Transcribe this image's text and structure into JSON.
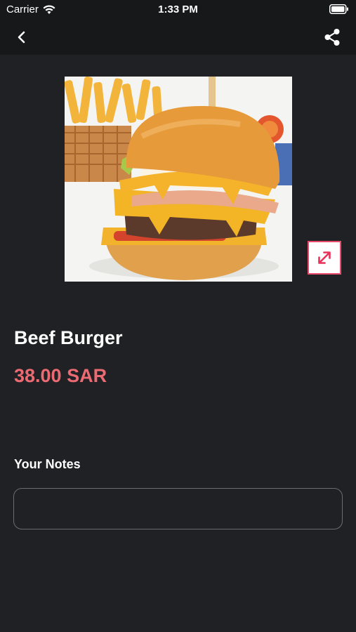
{
  "status_bar": {
    "carrier": "Carrier",
    "time": "1:33 PM"
  },
  "nav": {
    "back_icon": "chevron-left-icon",
    "share_icon": "share-icon"
  },
  "product": {
    "image_icon": "expand-icon",
    "name": "Beef Burger",
    "price": "38.00 SAR"
  },
  "notes": {
    "label": "Your Notes",
    "value": "",
    "placeholder": ""
  },
  "colors": {
    "background": "#202124",
    "bar": "#17181a",
    "price": "#ec6b73",
    "accent": "#e84a6a"
  }
}
